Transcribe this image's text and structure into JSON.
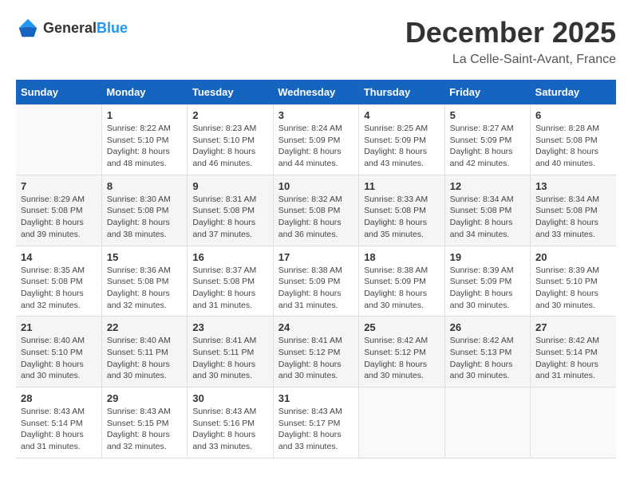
{
  "logo": {
    "text_general": "General",
    "text_blue": "Blue"
  },
  "title": {
    "month": "December 2025",
    "location": "La Celle-Saint-Avant, France"
  },
  "headers": [
    "Sunday",
    "Monday",
    "Tuesday",
    "Wednesday",
    "Thursday",
    "Friday",
    "Saturday"
  ],
  "weeks": [
    [
      {
        "day": "",
        "info": ""
      },
      {
        "day": "1",
        "info": "Sunrise: 8:22 AM\nSunset: 5:10 PM\nDaylight: 8 hours\nand 48 minutes."
      },
      {
        "day": "2",
        "info": "Sunrise: 8:23 AM\nSunset: 5:10 PM\nDaylight: 8 hours\nand 46 minutes."
      },
      {
        "day": "3",
        "info": "Sunrise: 8:24 AM\nSunset: 5:09 PM\nDaylight: 8 hours\nand 44 minutes."
      },
      {
        "day": "4",
        "info": "Sunrise: 8:25 AM\nSunset: 5:09 PM\nDaylight: 8 hours\nand 43 minutes."
      },
      {
        "day": "5",
        "info": "Sunrise: 8:27 AM\nSunset: 5:09 PM\nDaylight: 8 hours\nand 42 minutes."
      },
      {
        "day": "6",
        "info": "Sunrise: 8:28 AM\nSunset: 5:08 PM\nDaylight: 8 hours\nand 40 minutes."
      }
    ],
    [
      {
        "day": "7",
        "info": "Sunrise: 8:29 AM\nSunset: 5:08 PM\nDaylight: 8 hours\nand 39 minutes."
      },
      {
        "day": "8",
        "info": "Sunrise: 8:30 AM\nSunset: 5:08 PM\nDaylight: 8 hours\nand 38 minutes."
      },
      {
        "day": "9",
        "info": "Sunrise: 8:31 AM\nSunset: 5:08 PM\nDaylight: 8 hours\nand 37 minutes."
      },
      {
        "day": "10",
        "info": "Sunrise: 8:32 AM\nSunset: 5:08 PM\nDaylight: 8 hours\nand 36 minutes."
      },
      {
        "day": "11",
        "info": "Sunrise: 8:33 AM\nSunset: 5:08 PM\nDaylight: 8 hours\nand 35 minutes."
      },
      {
        "day": "12",
        "info": "Sunrise: 8:34 AM\nSunset: 5:08 PM\nDaylight: 8 hours\nand 34 minutes."
      },
      {
        "day": "13",
        "info": "Sunrise: 8:34 AM\nSunset: 5:08 PM\nDaylight: 8 hours\nand 33 minutes."
      }
    ],
    [
      {
        "day": "14",
        "info": "Sunrise: 8:35 AM\nSunset: 5:08 PM\nDaylight: 8 hours\nand 32 minutes."
      },
      {
        "day": "15",
        "info": "Sunrise: 8:36 AM\nSunset: 5:08 PM\nDaylight: 8 hours\nand 32 minutes."
      },
      {
        "day": "16",
        "info": "Sunrise: 8:37 AM\nSunset: 5:08 PM\nDaylight: 8 hours\nand 31 minutes."
      },
      {
        "day": "17",
        "info": "Sunrise: 8:38 AM\nSunset: 5:09 PM\nDaylight: 8 hours\nand 31 minutes."
      },
      {
        "day": "18",
        "info": "Sunrise: 8:38 AM\nSunset: 5:09 PM\nDaylight: 8 hours\nand 30 minutes."
      },
      {
        "day": "19",
        "info": "Sunrise: 8:39 AM\nSunset: 5:09 PM\nDaylight: 8 hours\nand 30 minutes."
      },
      {
        "day": "20",
        "info": "Sunrise: 8:39 AM\nSunset: 5:10 PM\nDaylight: 8 hours\nand 30 minutes."
      }
    ],
    [
      {
        "day": "21",
        "info": "Sunrise: 8:40 AM\nSunset: 5:10 PM\nDaylight: 8 hours\nand 30 minutes."
      },
      {
        "day": "22",
        "info": "Sunrise: 8:40 AM\nSunset: 5:11 PM\nDaylight: 8 hours\nand 30 minutes."
      },
      {
        "day": "23",
        "info": "Sunrise: 8:41 AM\nSunset: 5:11 PM\nDaylight: 8 hours\nand 30 minutes."
      },
      {
        "day": "24",
        "info": "Sunrise: 8:41 AM\nSunset: 5:12 PM\nDaylight: 8 hours\nand 30 minutes."
      },
      {
        "day": "25",
        "info": "Sunrise: 8:42 AM\nSunset: 5:12 PM\nDaylight: 8 hours\nand 30 minutes."
      },
      {
        "day": "26",
        "info": "Sunrise: 8:42 AM\nSunset: 5:13 PM\nDaylight: 8 hours\nand 30 minutes."
      },
      {
        "day": "27",
        "info": "Sunrise: 8:42 AM\nSunset: 5:14 PM\nDaylight: 8 hours\nand 31 minutes."
      }
    ],
    [
      {
        "day": "28",
        "info": "Sunrise: 8:43 AM\nSunset: 5:14 PM\nDaylight: 8 hours\nand 31 minutes."
      },
      {
        "day": "29",
        "info": "Sunrise: 8:43 AM\nSunset: 5:15 PM\nDaylight: 8 hours\nand 32 minutes."
      },
      {
        "day": "30",
        "info": "Sunrise: 8:43 AM\nSunset: 5:16 PM\nDaylight: 8 hours\nand 33 minutes."
      },
      {
        "day": "31",
        "info": "Sunrise: 8:43 AM\nSunset: 5:17 PM\nDaylight: 8 hours\nand 33 minutes."
      },
      {
        "day": "",
        "info": ""
      },
      {
        "day": "",
        "info": ""
      },
      {
        "day": "",
        "info": ""
      }
    ]
  ]
}
